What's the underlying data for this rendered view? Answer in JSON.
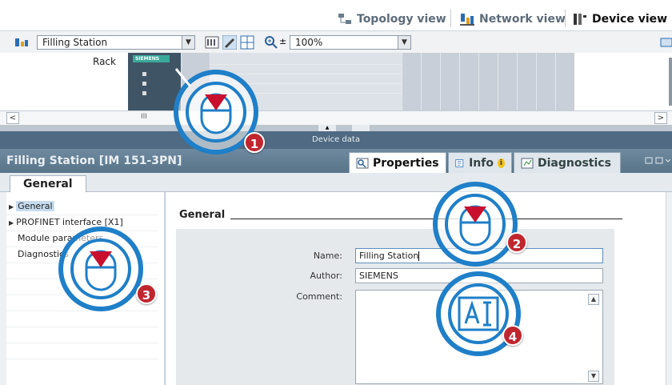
{
  "view_tabs": {
    "topology": "Topology view",
    "network": "Network view",
    "device": "Device view"
  },
  "toolbar": {
    "device_select": "Filling Station",
    "zoom": "100%"
  },
  "rack": {
    "label": "Rack",
    "module_brand": "SIEMENS"
  },
  "scroll_glyph": "III",
  "device_data_label": "Device data",
  "properties_panel": {
    "title": "Filling Station [IM 151-3PN]",
    "tabs": {
      "properties": "Properties",
      "info": "Info",
      "diagnostics": "Diagnostics"
    },
    "subtab": "General"
  },
  "nav": {
    "items": [
      {
        "label": "General"
      },
      {
        "label": "PROFINET interface [X1]"
      },
      {
        "label": "Module parameters"
      },
      {
        "label": "Diagnostics"
      }
    ]
  },
  "general_section": {
    "title": "General",
    "name_label": "Name:",
    "name_value": "Filling Station",
    "author_label": "Author:",
    "author_value": "SIEMENS",
    "comment_label": "Comment:"
  },
  "callouts": [
    "1",
    "2",
    "3",
    "4"
  ],
  "colors": {
    "header_blue": "#587488",
    "device_data_bar": "#4f6a82",
    "callout_ring": "#1f7fc8",
    "callout_number": "#c0262e",
    "cursor_arrow": "#c8102e"
  }
}
